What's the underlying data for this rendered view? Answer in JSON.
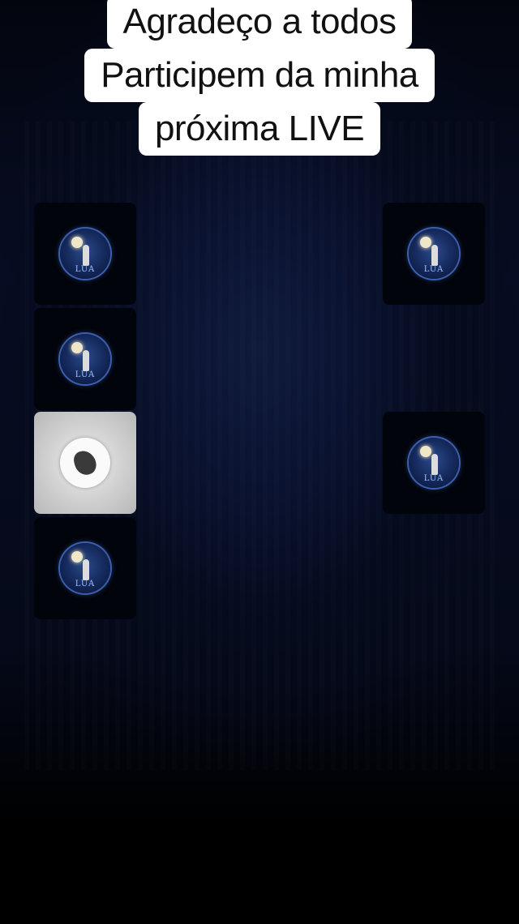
{
  "caption": {
    "lines": [
      "Agradeço a todos",
      "Participem da minha",
      "próxima LIVE"
    ]
  },
  "tiles": {
    "left": [
      {
        "avatar_logo": "LUA",
        "icon": "moon-profile-icon"
      },
      {
        "avatar_logo": "LUA",
        "icon": "moon-profile-icon"
      },
      {
        "avatar_logo": "",
        "icon": "butterfly-profile-icon",
        "selected": true
      },
      {
        "avatar_logo": "LUA",
        "icon": "moon-profile-icon"
      }
    ],
    "right": [
      {
        "avatar_logo": "LUA",
        "icon": "moon-profile-icon"
      },
      {
        "avatar_logo": "LUA",
        "icon": "moon-profile-icon"
      }
    ]
  },
  "colors": {
    "background": "#050a1c",
    "caption_bg": "#ffffff",
    "caption_text": "#111111",
    "selected_tile": "#cfcfcf"
  }
}
